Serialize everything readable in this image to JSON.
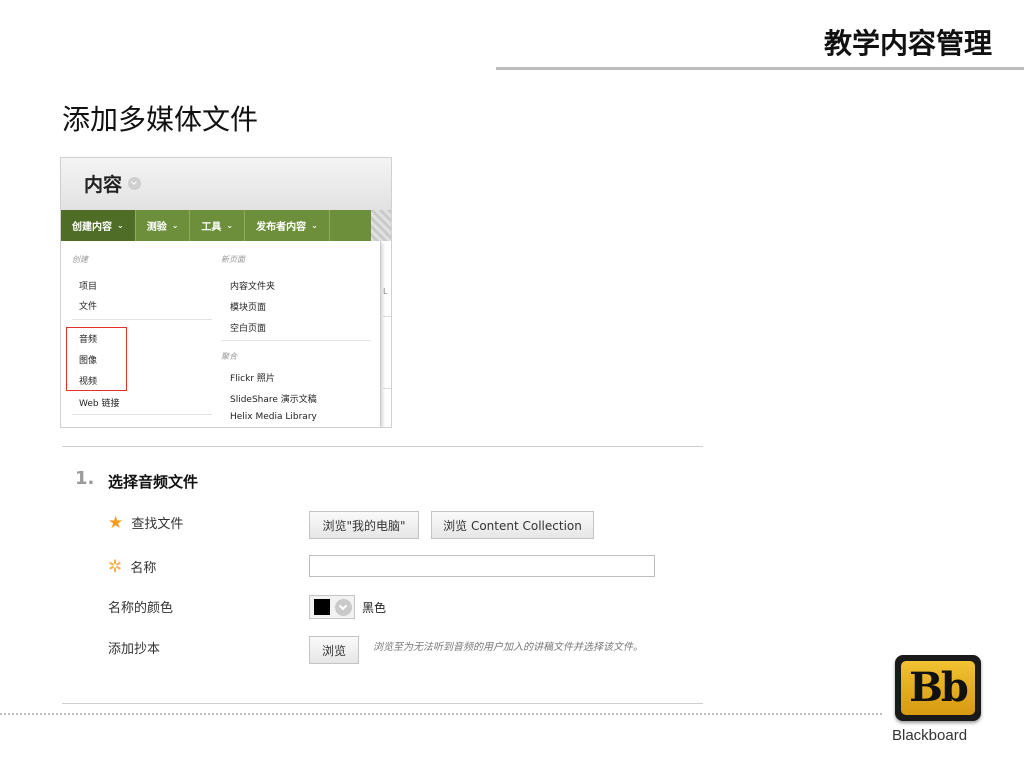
{
  "slide": {
    "title": "教学内容管理",
    "heading": "添加多媒体文件"
  },
  "menu": {
    "header_title": "内容",
    "tabs": [
      {
        "label": "创建内容"
      },
      {
        "label": "测验"
      },
      {
        "label": "工具"
      },
      {
        "label": "发布者内容"
      }
    ],
    "caret": "⌄",
    "left_group_label": "创建",
    "left_items": [
      "项目",
      "文件",
      "音频",
      "图像",
      "视频",
      "Web 链接"
    ],
    "right_group1_label": "新页面",
    "right_group1_items": [
      "内容文件夹",
      "模块页面",
      "空白页面"
    ],
    "right_group2_label": "聚合",
    "right_group2_items": [
      "Flickr 照片",
      "SlideShare 演示文稿",
      "Helix Media Library"
    ],
    "bleed_char": "L"
  },
  "form": {
    "step_number": "1.",
    "step_title": "选择音频文件",
    "find_file_label": "查找文件",
    "browse_computer_label": "浏览\"我的电脑\"",
    "browse_collection_label": "浏览 Content Collection",
    "name_label": "名称",
    "name_value": "",
    "name_color_label": "名称的颜色",
    "color_value": "#000000",
    "color_name": "黑色",
    "transcript_label": "添加抄本",
    "transcript_browse_label": "浏览",
    "transcript_hint": "浏览至为无法听到音频的用户加入的讲稿文件并选择该文件。",
    "required_star": "★",
    "optional_star": "✲"
  },
  "brand": {
    "mark": "Bb",
    "wordmark": "Blackboard",
    "accent": "#6d8f3c",
    "logo_gold": "#e8b020"
  }
}
